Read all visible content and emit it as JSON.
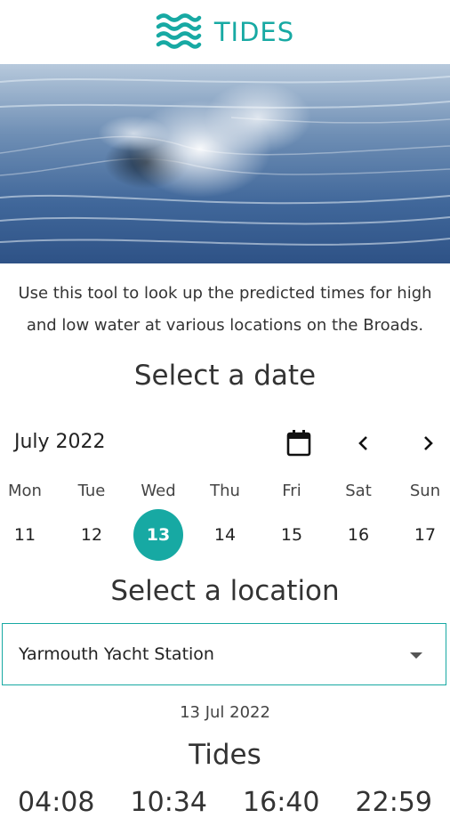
{
  "header": {
    "title": "TIDES",
    "logo_icon": "waves-icon",
    "accent_color": "#17a9a3"
  },
  "hero": {
    "image": "ocean-wave-photo"
  },
  "intro": {
    "line1": "Use this tool to look up the predicted times for high",
    "line2": "and low water at various locations on the Broads."
  },
  "date_section": {
    "title": "Select a date"
  },
  "calendar": {
    "month": "July 2022",
    "weekdays": [
      "Mon",
      "Tue",
      "Wed",
      "Thu",
      "Fri",
      "Sat",
      "Sun"
    ],
    "days": [
      "11",
      "12",
      "13",
      "14",
      "15",
      "16",
      "17"
    ],
    "selected_day": "13"
  },
  "location_section": {
    "title": "Select a location",
    "selected": "Yarmouth Yacht Station"
  },
  "results": {
    "date": "13 Jul 2022",
    "title": "Tides",
    "times": [
      "04:08",
      "10:34",
      "16:40",
      "22:59"
    ]
  }
}
